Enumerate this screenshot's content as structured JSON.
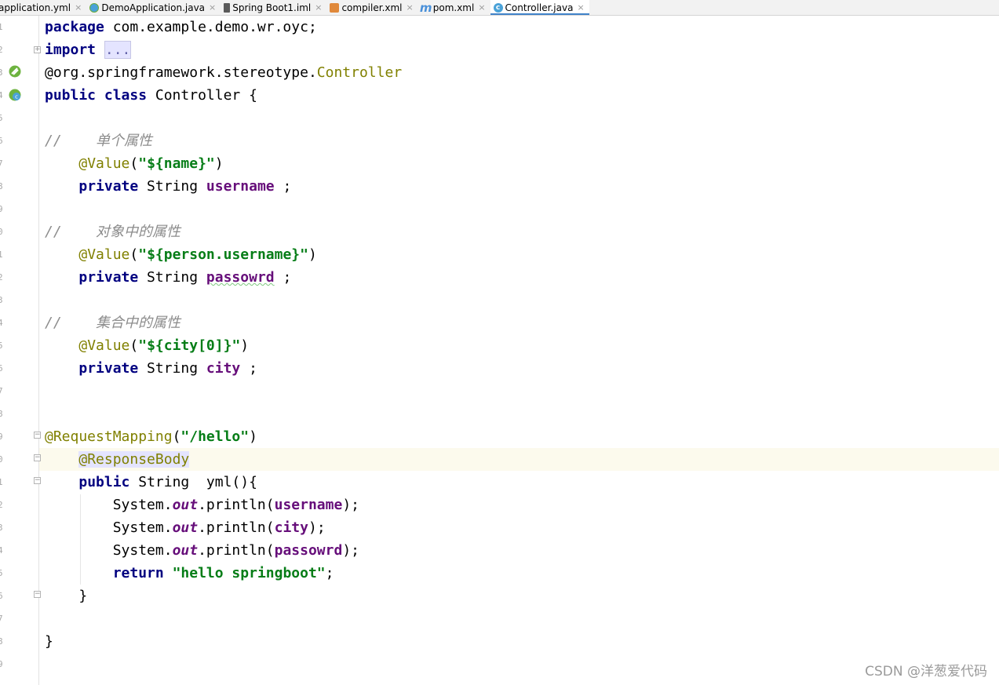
{
  "tabs": [
    {
      "label": "application.yml",
      "icon": "yml-file-icon"
    },
    {
      "label": "DemoApplication.java",
      "icon": "spring-class-icon"
    },
    {
      "label": "Spring Boot1.iml",
      "icon": "iml-file-icon"
    },
    {
      "label": "compiler.xml",
      "icon": "xml-file-icon"
    },
    {
      "label": "pom.xml",
      "icon": "maven-icon"
    },
    {
      "label": "Controller.java",
      "icon": "class-icon",
      "active": true
    }
  ],
  "tab_close_glyph": "×",
  "fold_glyphs": {
    "plus": "+",
    "minus": "−"
  },
  "line_numbers": [
    "1",
    "2",
    "3",
    "4",
    "5",
    "6",
    "7",
    "8",
    "9",
    "0",
    "1",
    "2",
    "3",
    "4",
    "5",
    "6",
    "7",
    "8",
    "9",
    "0",
    "1",
    "2",
    "3",
    "4",
    "5",
    "6",
    "7",
    "8",
    "9",
    "0"
  ],
  "code": {
    "l1": {
      "kw": "package",
      "rest": " com.example.demo.wr.oyc;"
    },
    "l2": {
      "kw": "import",
      "ellipsis": "..."
    },
    "l3": {
      "prefix": "@org.springframework.stereotype.",
      "ann": "Controller"
    },
    "l4": {
      "kw": "public class",
      "rest": " Controller {"
    },
    "l6": {
      "slashes": "//",
      "comment": "单个属性"
    },
    "l7": {
      "ann": "@Value",
      "open": "(",
      "str": "\"${name}\"",
      "close": ")"
    },
    "l8": {
      "kw": "private",
      "type": " String ",
      "field": "username",
      "end": " ;"
    },
    "l10": {
      "slashes": "//",
      "comment": "对象中的属性"
    },
    "l11": {
      "ann": "@Value",
      "open": "(",
      "str": "\"${person.username}\"",
      "close": ")"
    },
    "l12": {
      "kw": "private",
      "type": " String ",
      "field": "passowrd",
      "end": " ;"
    },
    "l14": {
      "slashes": "//",
      "comment": "集合中的属性"
    },
    "l15": {
      "ann": "@Value",
      "open": "(",
      "str": "\"${city[0]}\"",
      "close": ")"
    },
    "l16": {
      "kw": "private",
      "type": " String ",
      "field": "city",
      "end": " ;"
    },
    "l19": {
      "ann": "@RequestMapping",
      "open": "(",
      "str": "\"/hello\"",
      "close": ")"
    },
    "l20": {
      "ann": "@ResponseBody"
    },
    "l21": {
      "kw": "public",
      "rest": " String  yml(){"
    },
    "l22": {
      "obj": "System.",
      "static": "out",
      "call": ".println(",
      "field": "username",
      "end": ");"
    },
    "l23": {
      "obj": "System.",
      "static": "out",
      "call": ".println(",
      "field": "city",
      "end": ");"
    },
    "l24": {
      "obj": "System.",
      "static": "out",
      "call": ".println(",
      "field": "passowrd",
      "end": ");"
    },
    "l25": {
      "kw": "return",
      "str": "\"hello springboot\"",
      "end": ";"
    },
    "l26": {
      "text": "}"
    },
    "l28": {
      "text": "}"
    }
  },
  "watermark": "CSDN @洋葱爱代码"
}
